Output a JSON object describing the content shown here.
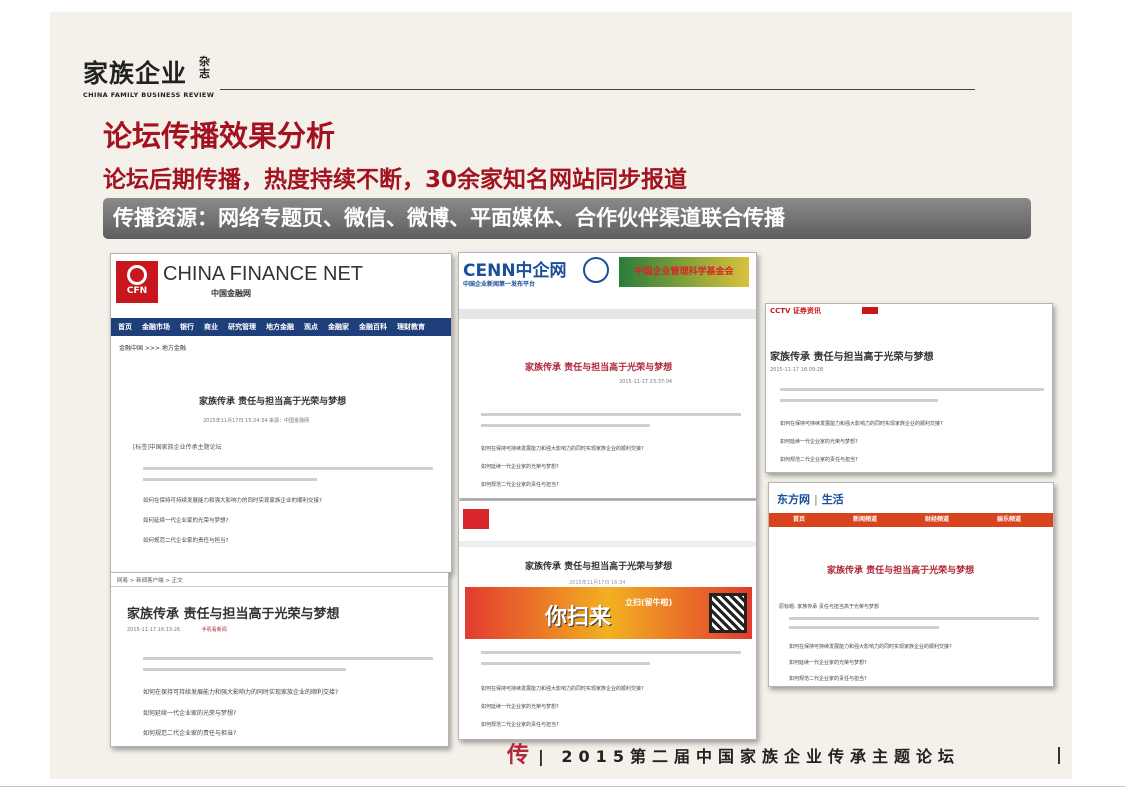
{
  "logo": {
    "main": "家族企业",
    "side": "杂志",
    "sub": "CHINA FAMILY BUSINESS REVIEW"
  },
  "title": "论坛传播效果分析",
  "subtitle_pre": "论坛后期传播，热度持续不断，",
  "subtitle_num": "30",
  "subtitle_post": "余家知名网站同步报道",
  "banner": "传播资源：网络专题页、微信、微博、平面媒体、合作伙伴渠道联合传播",
  "cards": {
    "cfn": {
      "brand": "CHINA FINANCE NET",
      "brand_cn": "中国金融网",
      "badge": "CFN",
      "nav": [
        "首页",
        "金融市场",
        "银行",
        "商业",
        "研究管理",
        "地方金融",
        "观点",
        "金融家",
        "金融百科",
        "理财教育"
      ],
      "breadcrumb": "金融中国 >>> 地方金融",
      "article_title": "家族传承 责任与担当高于光荣与梦想",
      "meta": "2015年11月17日 15:24:34 来源：中国金融网",
      "tag": "[标签]中国家族企业传承主题论坛",
      "q1": "如何在保持可持续发展能力和强大影响力的同时实现家族企业的顺利交接?",
      "q2": "如何延续一代企业家的光荣与梦想?",
      "q3": "如何规范二代企业家的责任与担当?"
    },
    "cenn": {
      "brand": "CENN中企网",
      "slogan": "中国企业新闻第一发布平台",
      "banner_text": "中国企业管理科学基金会",
      "article_title": "家族传承 责任与担当高于光荣与梦想",
      "meta": "2015-11-17 23:37:04",
      "q1": "如何在保持可持续发展能力和强大影响力的同时实现家族企业的顺利交接?",
      "q2": "如何延续一代企业家的光荣与梦想?",
      "q3": "如何规范二代企业家的责任与担当?"
    },
    "cctv": {
      "brand": "CCTV 证券资讯",
      "article_title": "家族传承 责任与担当高于光荣与梦想",
      "meta": "2015-11-17 16:09:28",
      "q1": "如何在保持可持续发展能力和强大影响力的同时实现家族企业的顺利交接?",
      "q2": "如何延续一代企业家的光荣与梦想?",
      "q3": "如何规范二代企业家的责任与担当?"
    },
    "bottom_left": {
      "breadcrumb": "网易 > 新闻客户端 > 正文",
      "article_title": "家族传承 责任与担当高于光荣与梦想",
      "meta": "2015-11-17 16:13:26",
      "source": "手机看新闻",
      "q1": "如何在保持可持续发展能力和强大影响力的同时实现家族企业的顺利交接?",
      "q2": "如何延续一代企业家的光荣与梦想?",
      "q3": "如何规范二代企业家的责任与担当?"
    },
    "middle": {
      "article_title": "家族传承 责任与担当高于光荣与梦想",
      "meta": "2015年11月17日 16:34",
      "ad_big": "你扫来",
      "ad_small": "立扫(留牛啦)",
      "q1": "如何在保持可持续发展能力和强大影响力的同时实现家族企业的顺利交接?",
      "q2": "如何延续一代企业家的光荣与梦想?",
      "q3": "如何规范二代企业家的责任与担当?"
    },
    "eastday": {
      "brand": "东方网",
      "brand_sub": "生活",
      "nav": [
        "首页",
        "新闻频道",
        "财经频道",
        "娱乐频道"
      ],
      "article_title": "家族传承 责任与担当高于光荣与梦想",
      "lead": "原标题: 家族传承 责任与担当高于光荣与梦想",
      "q1": "如何在保持可持续发展能力和强大影响力的同时实现家族企业的顺利交接?",
      "q2": "如何延续一代企业家的光荣与梦想?",
      "q3": "如何规范二代企业家的责任与担当?"
    }
  },
  "footer": {
    "mark": "传",
    "text": "| 2015第二届中国家族企业传承主题论坛"
  }
}
